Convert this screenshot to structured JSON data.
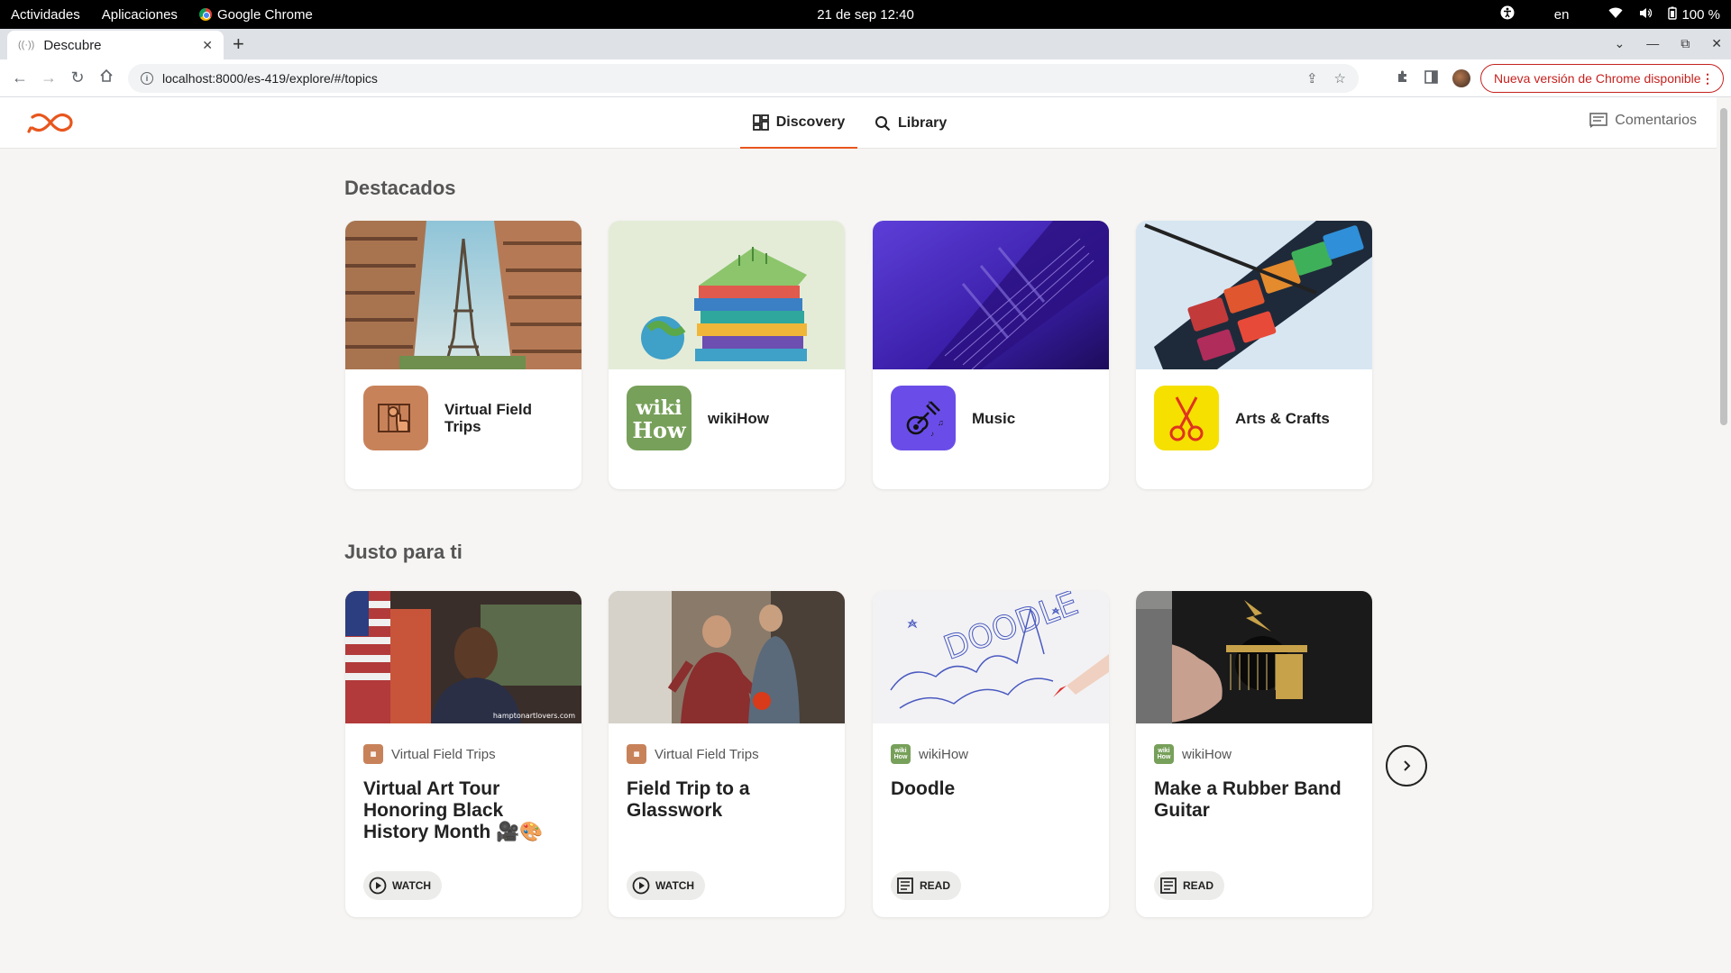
{
  "os_bar": {
    "activities": "Actividades",
    "applications": "Aplicaciones",
    "app_name": "Google Chrome",
    "datetime": "21 de sep  12:40",
    "language": "en",
    "battery": "100 %"
  },
  "browser": {
    "tab_title": "Descubre",
    "url": "localhost:8000/es-419/explore/#/topics",
    "update_button": "Nueva versión de Chrome disponible"
  },
  "app_header": {
    "nav": [
      {
        "label": "Discovery",
        "icon": "grid-icon",
        "active": true
      },
      {
        "label": "Library",
        "icon": "search-icon",
        "active": false
      }
    ],
    "feedback_label": "Comentarios",
    "accent": "#e8561d"
  },
  "featured": {
    "title": "Destacados",
    "items": [
      {
        "label": "Virtual Field Trips",
        "icon": "map-pointer-icon",
        "icon_color": "#c8825a"
      },
      {
        "label": "wikiHow",
        "icon": "wikihow-logo-icon",
        "icon_color": "#77a05a"
      },
      {
        "label": "Music",
        "icon": "guitar-icon",
        "icon_color": "#6a4de8"
      },
      {
        "label": "Arts & Crafts",
        "icon": "scissors-icon",
        "icon_color": "#f5e000"
      }
    ]
  },
  "for_you": {
    "title": "Justo para ti",
    "items": [
      {
        "source": "Virtual Field Trips",
        "title": "Virtual Art Tour Honoring Black History Month 🎥🎨",
        "action": "WATCH",
        "action_icon": "play-circle-icon",
        "watermark": "hamptonartlovers.com"
      },
      {
        "source": "Virtual Field Trips",
        "title": "Field Trip to a Glasswork",
        "action": "WATCH",
        "action_icon": "play-circle-icon"
      },
      {
        "source": "wikiHow",
        "title": "Doodle",
        "action": "READ",
        "action_icon": "article-icon"
      },
      {
        "source": "wikiHow",
        "title": "Make a Rubber Band Guitar",
        "action": "READ",
        "action_icon": "article-icon"
      }
    ]
  }
}
